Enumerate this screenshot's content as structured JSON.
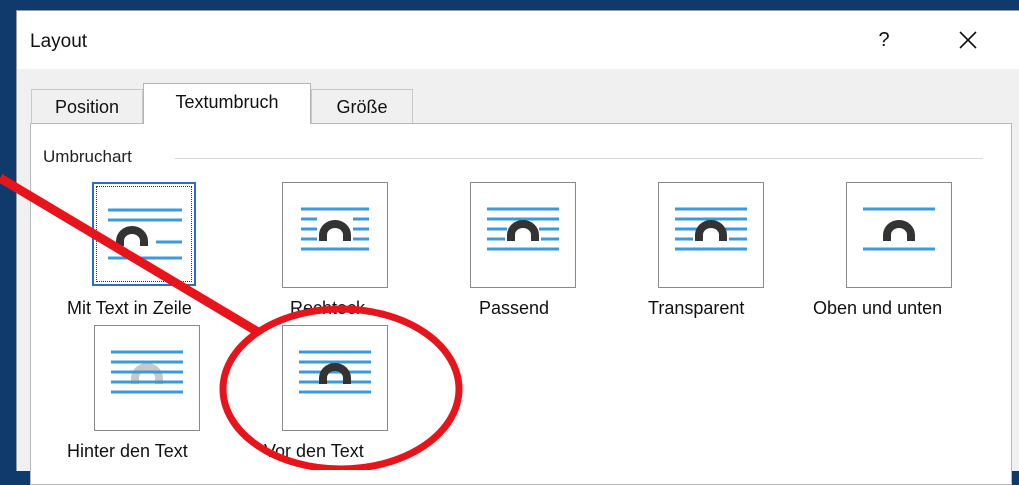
{
  "dialog": {
    "title": "Layout",
    "help_label": "?",
    "close_icon": "close-icon"
  },
  "tabs": [
    {
      "label": "Position",
      "active": false
    },
    {
      "label": "Textumbruch",
      "active": true
    },
    {
      "label": "Größe",
      "active": false
    }
  ],
  "wrap_group": {
    "label": "Umbruchart",
    "options": [
      {
        "label": "Mit Text in Zeile",
        "icon": "inline-with-text-icon",
        "selected": true
      },
      {
        "label": "Rechteck",
        "icon": "square-wrap-icon",
        "selected": false
      },
      {
        "label": "Passend",
        "icon": "tight-wrap-icon",
        "selected": false
      },
      {
        "label": "Transparent",
        "icon": "through-wrap-icon",
        "selected": false
      },
      {
        "label": "Oben und unten",
        "icon": "top-and-bottom-icon",
        "selected": false
      },
      {
        "label": "Hinter den Text",
        "icon": "behind-text-icon",
        "selected": false
      },
      {
        "label": "Vor den Text",
        "icon": "in-front-of-text-icon",
        "selected": false
      }
    ]
  },
  "annotation": {
    "arrow_color": "#e8141b",
    "circle_color": "#e8141b"
  },
  "colors": {
    "background": "#0f3a6b",
    "text_line": "#3b9ad9",
    "shape_dark": "#333333",
    "shape_light": "#c8c8c8",
    "selection": "#2b6cc4"
  }
}
